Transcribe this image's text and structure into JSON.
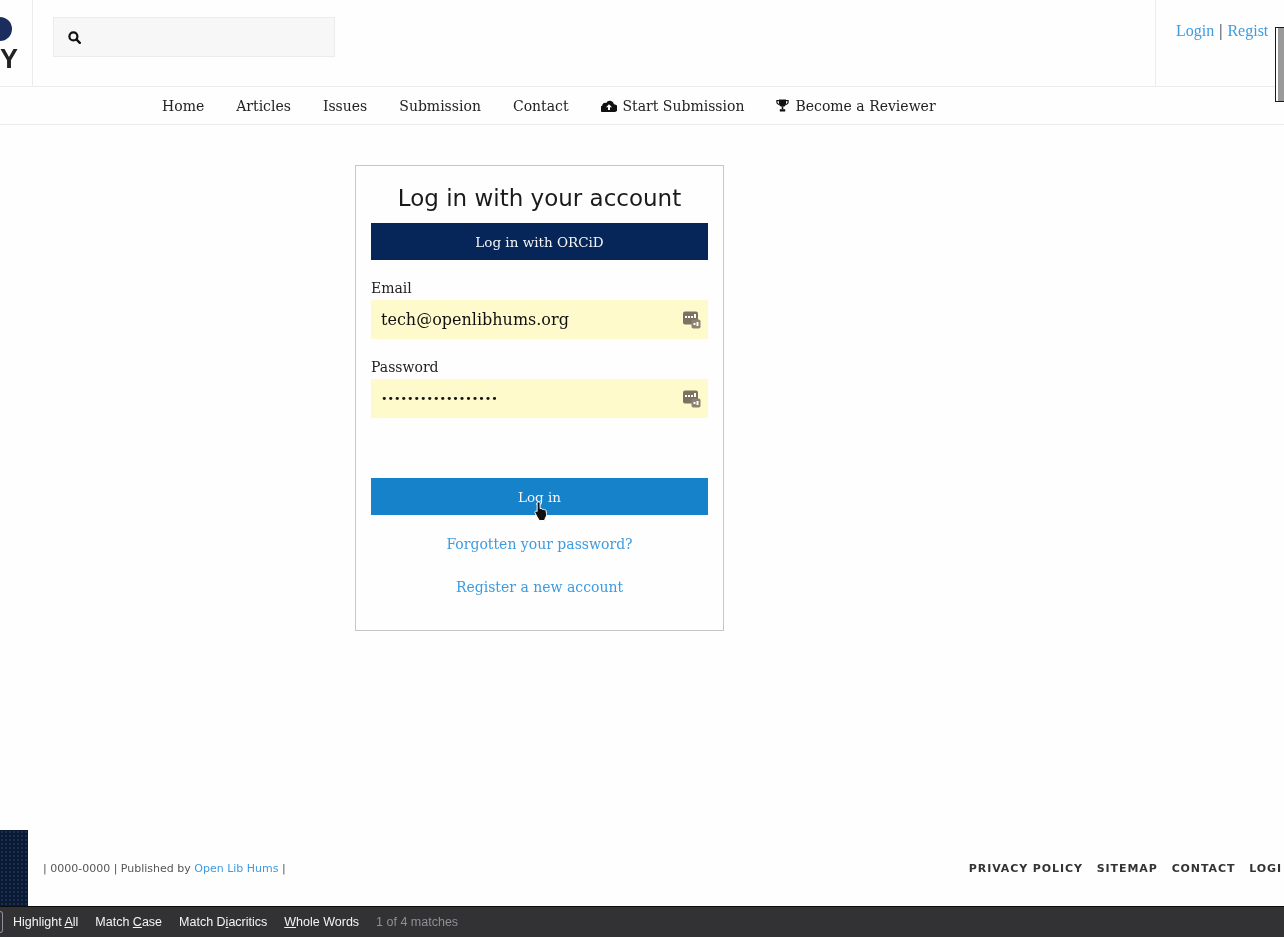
{
  "header": {
    "logo": {
      "text": "Y"
    },
    "account": {
      "links": [
        "Login",
        "Regist"
      ],
      "separator": "|"
    }
  },
  "nav": [
    {
      "label": "Home",
      "kind": "page"
    },
    {
      "label": "Articles",
      "kind": "page"
    },
    {
      "label": "Issues",
      "kind": "page"
    },
    {
      "label": "Submission",
      "kind": "page"
    },
    {
      "label": "Contact",
      "kind": "page"
    },
    {
      "label": "Start Submission",
      "kind": "submission"
    },
    {
      "label": "Become a Reviewer",
      "kind": "reviewer"
    }
  ],
  "login_card": {
    "title": "Log in with your account",
    "orcid_button": "Log in with ORCiD",
    "fields": [
      {
        "label": "Email",
        "kind": "email",
        "value": "tech@openlibhums.org",
        "autofilled": true
      },
      {
        "label": "Password",
        "kind": "password",
        "value": "••••••••••••••••••",
        "autofilled": true
      }
    ],
    "submit_button": "Log in",
    "links": [
      "Forgotten your password?",
      "Register a new account"
    ]
  },
  "footer": {
    "credit": {
      "before": "| 0000-0000 | Published by",
      "link": "Open Lib Hums",
      "after": "|"
    },
    "links": [
      "PRIVACY POLICY",
      "SITEMAP",
      "CONTACT",
      "LOGI"
    ]
  },
  "find_bar": {
    "options": [
      {
        "before": "Highlight ",
        "key": "A",
        "after": "ll"
      },
      {
        "before": "Match ",
        "key": "C",
        "after": "ase"
      },
      {
        "before": "Match D",
        "key": "i",
        "after": "acritics"
      },
      {
        "key": "W",
        "after": "hole Words"
      }
    ],
    "match_count": "1 of 4 matches"
  }
}
